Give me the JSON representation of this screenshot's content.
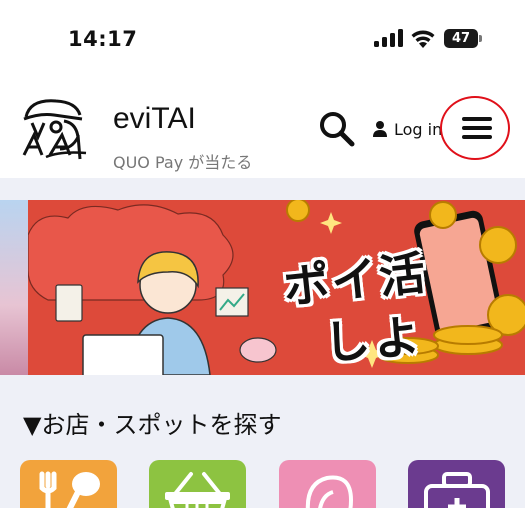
{
  "status_bar": {
    "time": "14:17",
    "battery": "47",
    "signal_icon": "cellular-signal-icon",
    "wifi_icon": "wifi-icon"
  },
  "header": {
    "site_title": "eviTAI",
    "tagline": "QUO Pay が当たる",
    "login_label": "Log in",
    "icons": [
      "logo-icon",
      "search-icon",
      "user-icon",
      "hamburger-menu-icon"
    ],
    "highlight_color": "#e0101a"
  },
  "banner": {
    "line1": "ポイ活",
    "line2": "しよう！",
    "background_color": "#dd4a3a"
  },
  "section": {
    "title": "▼お店・スポットを探す",
    "categories": [
      {
        "icon": "restaurant-icon",
        "color": "#f2a33c"
      },
      {
        "icon": "shopping-basket-icon",
        "color": "#8dc341"
      },
      {
        "icon": "beauty-icon",
        "color": "#ee8fb4"
      },
      {
        "icon": "medical-bag-icon",
        "color": "#6b3b8f"
      }
    ]
  }
}
